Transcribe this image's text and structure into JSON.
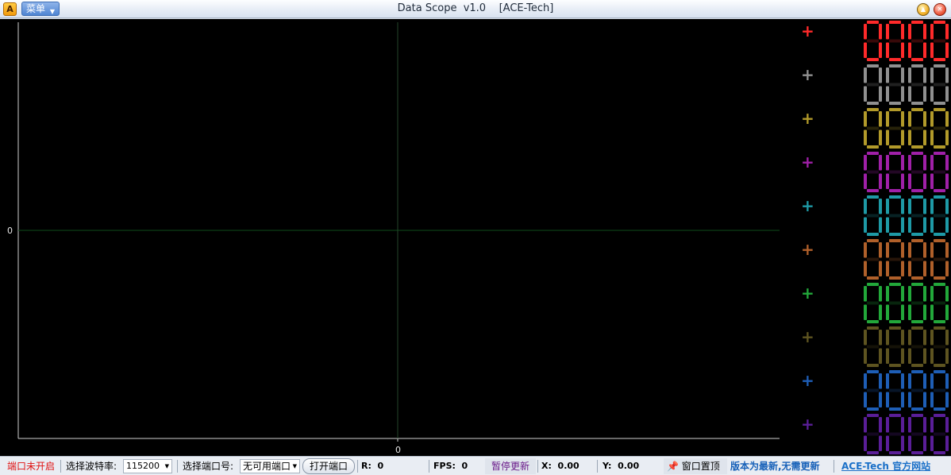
{
  "titlebar": {
    "app_icon_label": "A",
    "menu_label": "菜单",
    "title": "Data Scope  v1.0    [ACE-Tech]"
  },
  "plot": {
    "y_zero_label": "0",
    "x_zero_label": "0",
    "background": "#000000",
    "axis_color": "#cccccc",
    "crosshair_color": "#0e4d1a"
  },
  "channels": [
    {
      "color": "#ff2a2a",
      "display": "0000"
    },
    {
      "color": "#909090",
      "display": "0000"
    },
    {
      "color": "#b29a2a",
      "display": "0000"
    },
    {
      "color": "#a020a8",
      "display": "0000"
    },
    {
      "color": "#1e9aa6",
      "display": "0000"
    },
    {
      "color": "#b0602a",
      "display": "0000"
    },
    {
      "color": "#22a83a",
      "display": "0000"
    },
    {
      "color": "#5e5420",
      "display": "0000"
    },
    {
      "color": "#1e5eb6",
      "display": "0000"
    },
    {
      "color": "#5a1e98",
      "display": "0000"
    }
  ],
  "status": {
    "port_state": "端口未开启",
    "baud_label": "选择波特率:",
    "baud_value": "115200",
    "port_label": "选择端口号:",
    "port_value": "无可用端口",
    "open_port": "打开端口",
    "r_label": "R:  0",
    "fps_label": "FPS:  0",
    "pause_update": "暂停更新",
    "x_label": "X:  0.00",
    "y_label": "Y:  0.00",
    "pin_window": "窗口置顶",
    "version_info": "版本为最新,无需更新",
    "site_link": "ACE-Tech 官方网站"
  }
}
